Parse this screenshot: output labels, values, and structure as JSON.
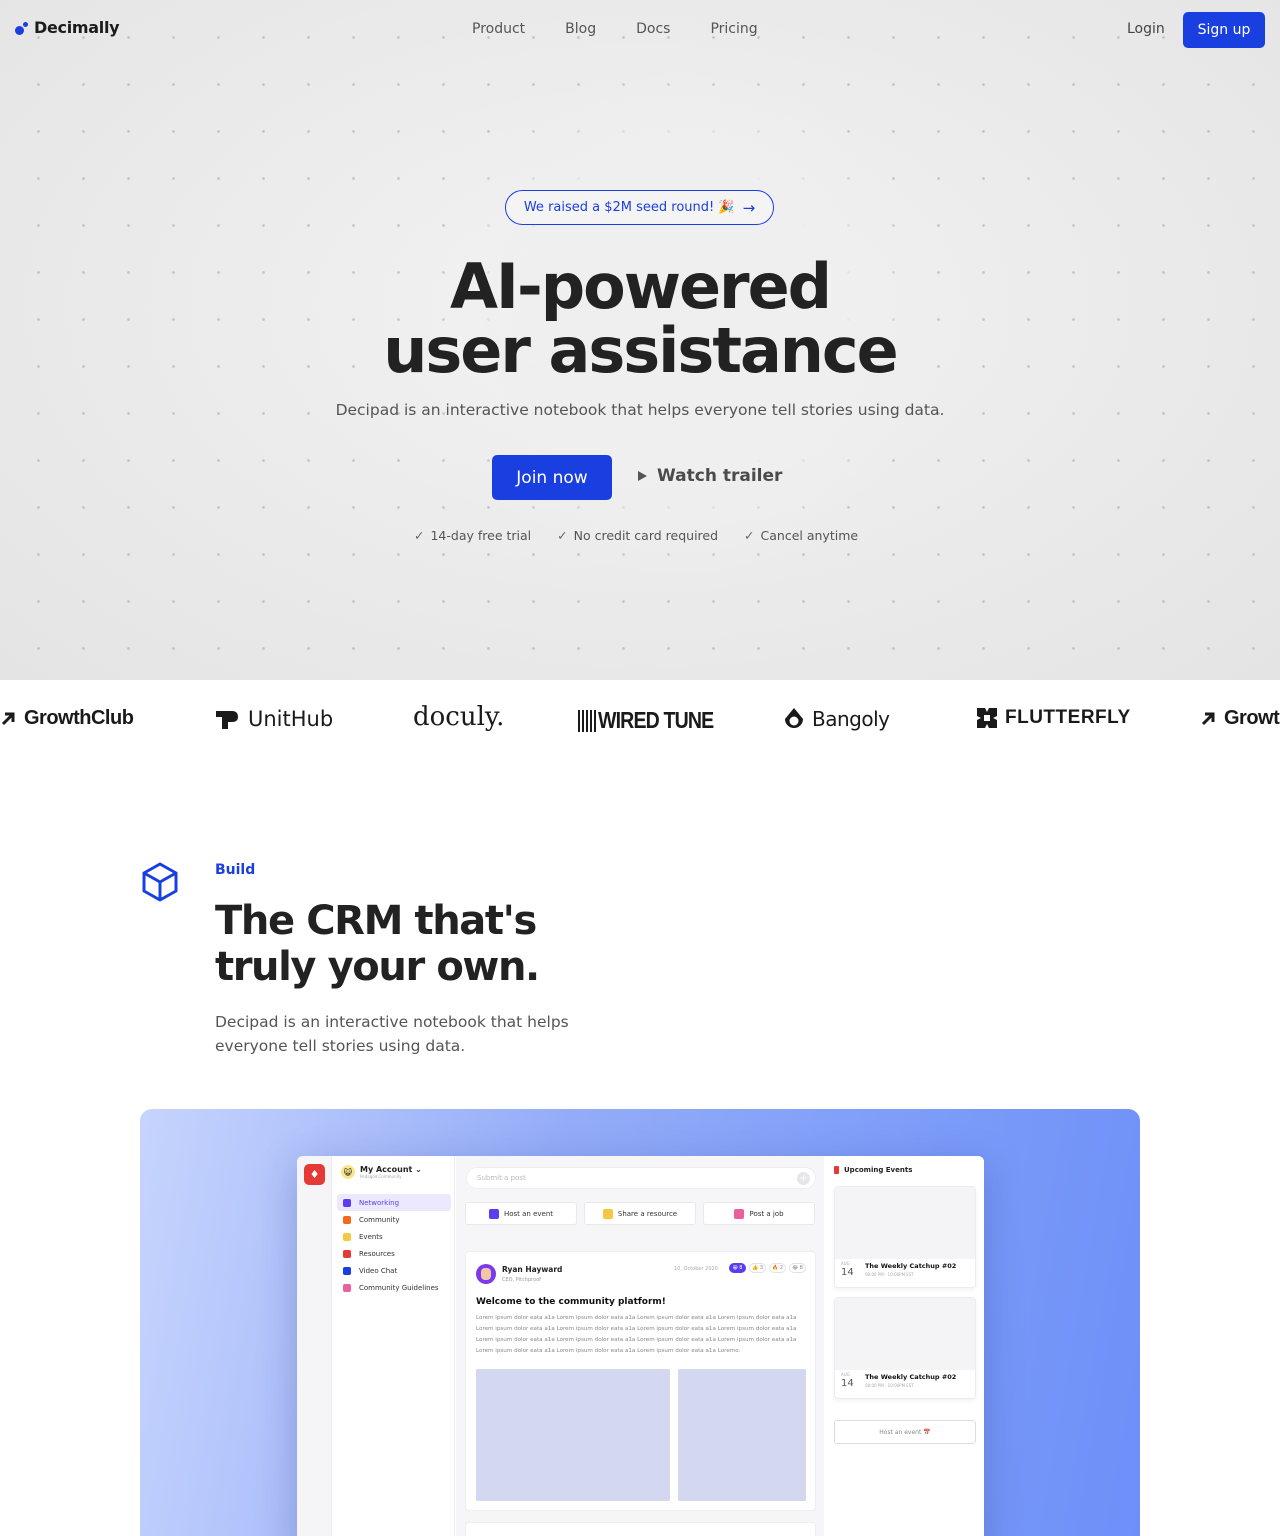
{
  "nav": {
    "brand": "Decimally",
    "links": [
      "Product",
      "Blog",
      "Docs",
      "Pricing"
    ],
    "login": "Login",
    "signup": "Sign up"
  },
  "hero": {
    "announcement": "We raised a $2M seed round! 🎉",
    "announcement_arrow": "→",
    "title_line1": "AI-powered",
    "title_line2": "user assistance",
    "subtitle": "Decipad is an interactive notebook that helps everyone tell stories using data.",
    "cta_primary": "Join now",
    "cta_secondary": "Watch trailer",
    "checks": [
      "14-day free trial",
      "No credit card required",
      "Cancel anytime"
    ]
  },
  "logos": [
    "GrowthClub",
    "UnitHub",
    "doculy.",
    "WIRED TUNE",
    "Bangoly",
    "FLUTTERFLY",
    "Growt"
  ],
  "build": {
    "eyebrow": "Build",
    "title_line1": "The CRM that's",
    "title_line2": "truly your own.",
    "description": "Decipad is an interactive notebook that helps everyone tell stories using data."
  },
  "mock_app": {
    "account": "My Account",
    "account_sub": "Pedagod Community",
    "menu": [
      {
        "label": "Networking",
        "color": "#5b3cf0",
        "active": true
      },
      {
        "label": "Community",
        "color": "#f26b1d"
      },
      {
        "label": "Events",
        "color": "#f5c843"
      },
      {
        "label": "Resources",
        "color": "#e53935"
      },
      {
        "label": "Video Chat",
        "color": "#1a3fe0"
      },
      {
        "label": "Community Guidelines",
        "color": "#ec5f9f"
      }
    ],
    "post_placeholder": "Submit a post",
    "actions": [
      {
        "label": "Host an event",
        "color": "#5b3cf0"
      },
      {
        "label": "Share a resource",
        "color": "#f5c843"
      },
      {
        "label": "Post a job",
        "color": "#ec5f9f"
      }
    ],
    "post": {
      "author": "Ryan Hayward",
      "role": "CEO, Pitchproof",
      "date": "10, October 2020",
      "reactions": [
        "😀 8",
        "👍 3",
        "🔥 2",
        "😂 8"
      ],
      "title": "Welcome to the community platform!",
      "body": "Lorem ipsum dolor eata a1a Lorem ipsum dolor eata a1a Lorem ipsum dolor eata a1a Lorem ipsum dolor eata a1a Lorem ipsum dolor eata a1a Lorem ipsum dolor eata a1a Lorem ipsum dolor eata a1a Lorem ipsum dolor eata a1a Lorem ipsum dolor eata a1a Lorem ipsum dolor eata a1a Lorem ipsum dolor eata a1a Lorem ipsum dolor eata a1a Lorem ipsum dolor eata a1a Lorem ipsum dolor eata a1a Lorem ipsum dolor eata a1a Loremo."
    },
    "events_title": "Upcoming Events",
    "events": [
      {
        "month": "AUG",
        "day": "14",
        "name": "The Weekly Catchup #02",
        "time": "08:00 PM - 10:00PM EST"
      },
      {
        "month": "AUG",
        "day": "14",
        "name": "The Weekly Catchup #02",
        "time": "08:00 PM - 10:00PM EST"
      }
    ],
    "host_button": "Host an event 📅"
  },
  "colors": {
    "accent": "#1a3fe0",
    "text": "#222222"
  }
}
